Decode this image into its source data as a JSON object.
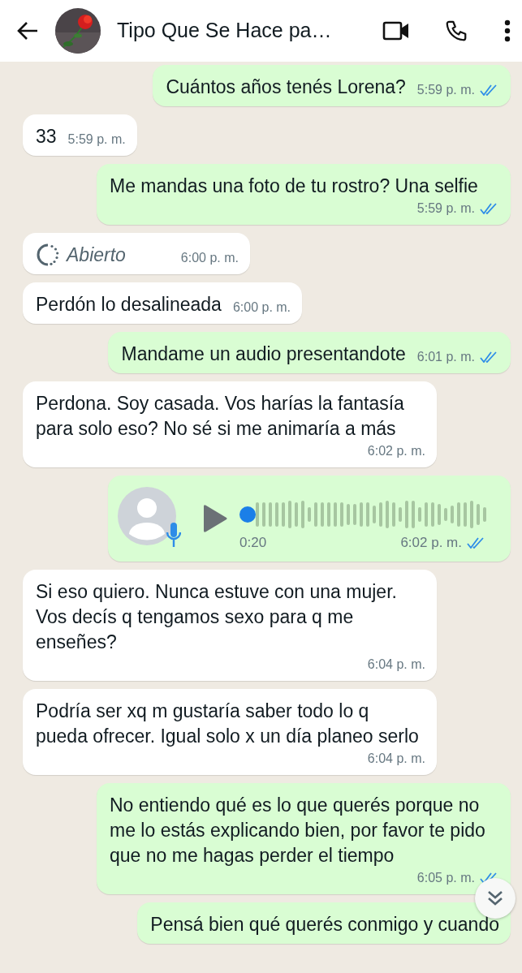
{
  "header": {
    "contact_name": "Tipo Que Se Hace pa…"
  },
  "messages": [
    {
      "kind": "text",
      "outgoing": true,
      "text": "Cuántos años tenés Lorena?",
      "time": "5:59 p. m.",
      "read": true
    },
    {
      "kind": "text",
      "outgoing": false,
      "text": "33",
      "time": "5:59 p. m."
    },
    {
      "kind": "text",
      "outgoing": true,
      "text": "Me mandas una foto de tu rostro? Una selfie",
      "time": "5:59 p. m.",
      "read": true
    },
    {
      "kind": "view_once",
      "outgoing": false,
      "text": "Abierto",
      "time": "6:00 p. m."
    },
    {
      "kind": "text",
      "outgoing": false,
      "text": "Perdón lo desalineada",
      "time": "6:00 p. m."
    },
    {
      "kind": "text",
      "outgoing": true,
      "text": "Mandame un audio presentandote",
      "time": "6:01 p. m.",
      "read": true
    },
    {
      "kind": "text",
      "outgoing": false,
      "text": "Perdona. Soy casada. Vos harías la fantasía para solo eso? No sé si me animaría a más",
      "time": "6:02 p. m."
    },
    {
      "kind": "audio",
      "outgoing": true,
      "duration": "0:20",
      "time": "6:02 p. m.",
      "read": true
    },
    {
      "kind": "text",
      "outgoing": false,
      "text": "Si eso quiero. Nunca estuve con una mujer. Vos decís q tengamos sexo para q me enseñes?",
      "time": "6:04 p. m."
    },
    {
      "kind": "text",
      "outgoing": false,
      "text": "Podría ser xq m gustaría saber todo lo q pueda ofrecer. Igual solo x un día planeo serlo",
      "time": "6:04 p. m."
    },
    {
      "kind": "text",
      "outgoing": true,
      "text": "No entiendo qué es lo que querés porque no me lo estás explicando bien, por favor te pido que no me hagas perder el tiempo",
      "time": "6:05 p. m.",
      "read": true
    },
    {
      "kind": "text",
      "outgoing": true,
      "text": "Pensá bien qué querés conmigo y cuando"
    }
  ]
}
